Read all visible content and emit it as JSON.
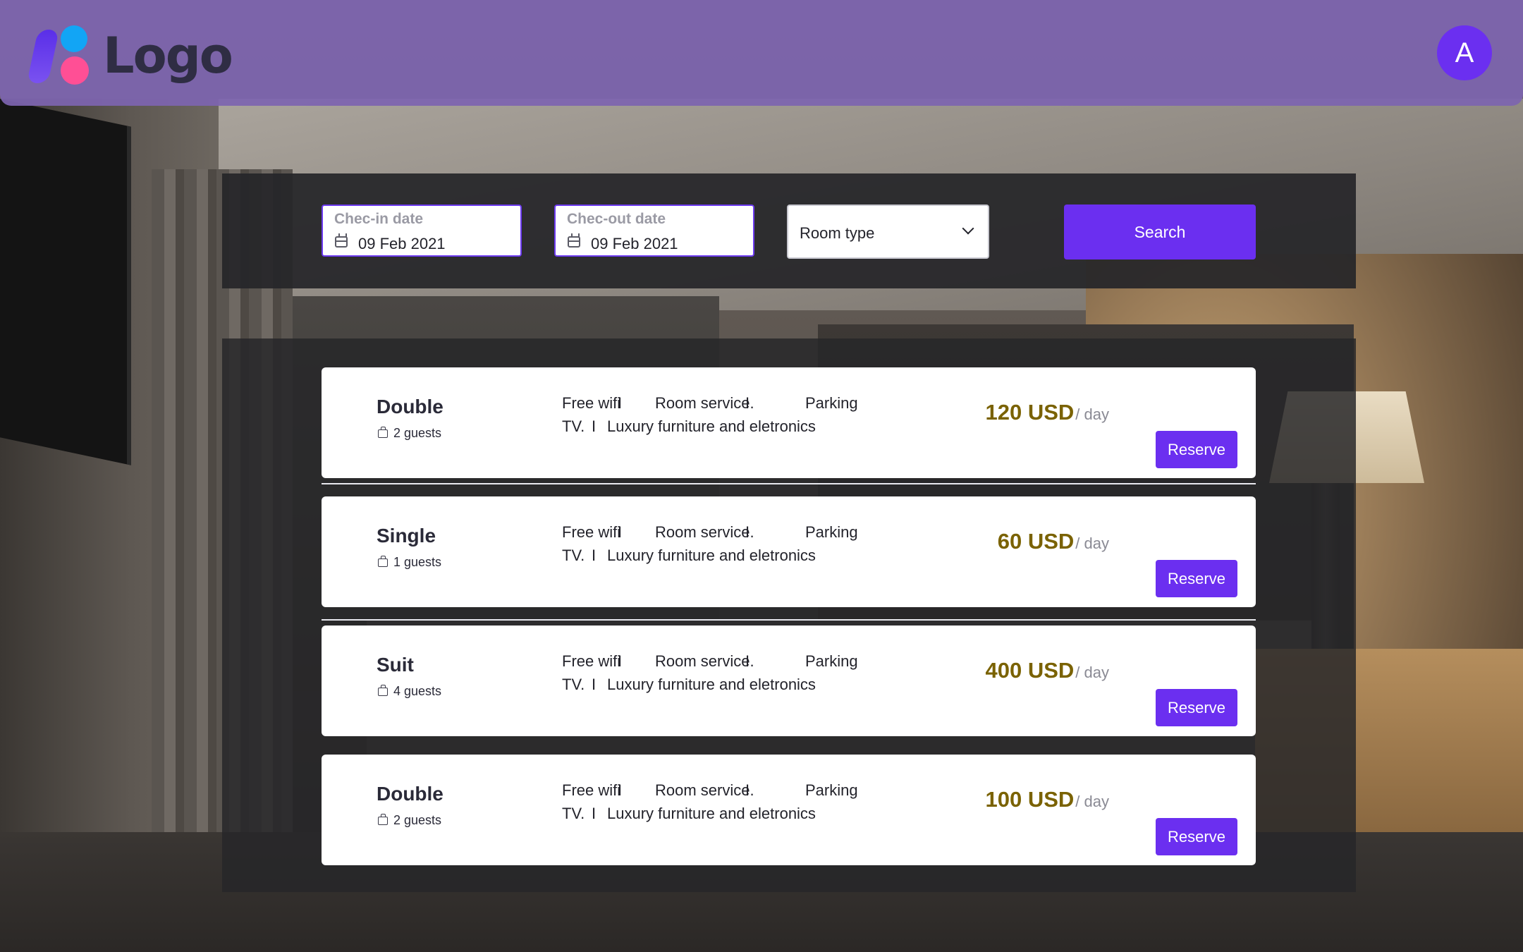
{
  "header": {
    "logo_text": "Logo",
    "avatar_initial": "A",
    "brand_color": "#6b2ff0"
  },
  "search": {
    "checkin": {
      "label": "Chec-in date",
      "value": "09 Feb 2021",
      "icon": "calendar-icon"
    },
    "checkout": {
      "label": "Chec-out date",
      "value": "09 Feb 2021",
      "icon": "calendar-icon"
    },
    "room_type": {
      "selected": "Room type",
      "icon": "chevron-down-icon"
    },
    "search_label": "Search"
  },
  "rooms": [
    {
      "name": "Double",
      "guests": "2 guests",
      "features": [
        "Free wifi",
        "Room service.",
        "Parking",
        "TV.",
        "Luxury furniture and eletronics"
      ],
      "separator": "I",
      "price": "120 USD",
      "per": "/ day",
      "reserve_label": "Reserve"
    },
    {
      "name": "Single",
      "guests": "1 guests",
      "features": [
        "Free wifi",
        "Room service.",
        "Parking",
        "TV.",
        "Luxury furniture and eletronics"
      ],
      "separator": "I",
      "price": "60 USD",
      "per": "/ day",
      "reserve_label": "Reserve"
    },
    {
      "name": "Suit",
      "guests": "4 guests",
      "features": [
        "Free wifi",
        "Room service.",
        "Parking",
        "TV.",
        "Luxury furniture and eletronics"
      ],
      "separator": "I",
      "price": "400 USD",
      "per": "/ day",
      "reserve_label": "Reserve"
    },
    {
      "name": "Double",
      "guests": "2 guests",
      "features": [
        "Free wifi",
        "Room service.",
        "Parking",
        "TV.",
        "Luxury furniture and eletronics"
      ],
      "separator": "I",
      "price": "100 USD",
      "per": "/ day",
      "reserve_label": "Reserve"
    }
  ],
  "colors": {
    "price": "#7a6200",
    "accent": "#6b2ff0",
    "header_bg": "#7d64af"
  }
}
